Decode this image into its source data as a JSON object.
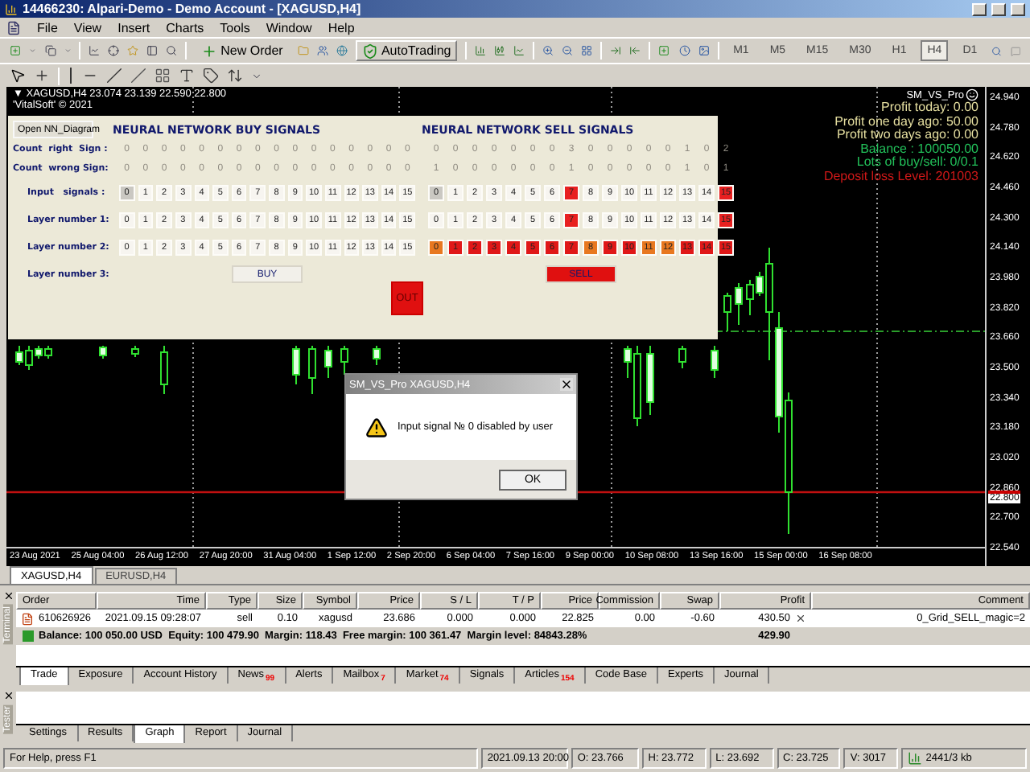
{
  "window": {
    "title": "14466230: Alpari-Demo - Demo Account - [XAGUSD,H4]"
  },
  "menu": [
    "File",
    "View",
    "Insert",
    "Charts",
    "Tools",
    "Window",
    "Help"
  ],
  "toolbar": {
    "new_order": "New Order",
    "autotrading": "AutoTrading",
    "timeframes": [
      {
        "label": "M1",
        "selected": false
      },
      {
        "label": "M5",
        "selected": false
      },
      {
        "label": "M15",
        "selected": false
      },
      {
        "label": "M30",
        "selected": false
      },
      {
        "label": "H1",
        "selected": false
      },
      {
        "label": "H4",
        "selected": true
      },
      {
        "label": "D1",
        "selected": false
      }
    ]
  },
  "chart": {
    "header": "▼ XAGUSD,H4  23.074 23.139 22.590 22.800",
    "copyright": "'VitalSoft' © 2021",
    "expert_name": "SM_VS_Pro",
    "info": [
      {
        "text": "Profit today: 0.00",
        "color": "#e6dfa0"
      },
      {
        "text": "Profit one day ago: 50.00",
        "color": "#e6dfa0"
      },
      {
        "text": "Profit two days ago: 0.00",
        "color": "#e6dfa0"
      },
      {
        "text": "Balance : 100050.00",
        "color": "#22c05a"
      },
      {
        "text": "Lots of buy/sell: 0/0.1",
        "color": "#22c05a"
      },
      {
        "text": "Deposit loss Level: 201003",
        "color": "#d01818"
      }
    ],
    "price_axis": [
      "24.940",
      "24.780",
      "24.620",
      "24.460",
      "24.300",
      "24.140",
      "23.980",
      "23.820",
      "23.660",
      "23.500",
      "23.340",
      "23.180",
      "23.020",
      "22.860",
      "22.700",
      "22.540"
    ],
    "current_price": "22.800",
    "time_axis": [
      "23 Aug 2021",
      "25 Aug 04:00",
      "26 Aug 12:00",
      "27 Aug 20:00",
      "31 Aug 04:00",
      "1 Sep 12:00",
      "2 Sep 20:00",
      "6 Sep 04:00",
      "7 Sep 16:00",
      "9 Sep 00:00",
      "10 Sep 08:00",
      "13 Sep 16:00",
      "15 Sep 00:00",
      "16 Sep 08:00"
    ]
  },
  "nn_panel": {
    "open_button": "Open NN_Diagram",
    "buy_title": "NEURAL NETWORK BUY SIGNALS",
    "sell_title": "NEURAL NETWORK SELL SIGNALS",
    "count_rows": [
      {
        "label": "Count  right  Sign :",
        "buy": [
          "0",
          "0",
          "0",
          "0",
          "0",
          "0",
          "0",
          "0",
          "0",
          "0",
          "0",
          "0",
          "0",
          "0",
          "0",
          "0"
        ],
        "sell": [
          "0",
          "0",
          "0",
          "0",
          "0",
          "0",
          "0",
          "3",
          "0",
          "0",
          "0",
          "0",
          "0",
          "1",
          "0",
          "2"
        ]
      },
      {
        "label": "Count  wrong Sign:",
        "buy": [
          "0",
          "0",
          "0",
          "0",
          "0",
          "0",
          "0",
          "0",
          "0",
          "0",
          "0",
          "0",
          "0",
          "0",
          "0",
          "0"
        ],
        "sell": [
          "1",
          "0",
          "0",
          "0",
          "0",
          "0",
          "0",
          "1",
          "0",
          "0",
          "0",
          "0",
          "0",
          "1",
          "0",
          "1"
        ]
      }
    ],
    "cell_rows": [
      {
        "label": "Input   signals :",
        "buy": [
          {
            "text": "0",
            "color": "#cac8c2"
          },
          {
            "text": "1",
            "color": "#f7f5f0"
          },
          {
            "text": "2",
            "color": "#f7f5f0"
          },
          {
            "text": "3",
            "color": "#f7f5f0"
          },
          {
            "text": "4",
            "color": "#f7f5f0"
          },
          {
            "text": "5",
            "color": "#f7f5f0"
          },
          {
            "text": "6",
            "color": "#f7f5f0"
          },
          {
            "text": "7",
            "color": "#f7f5f0"
          },
          {
            "text": "8",
            "color": "#f7f5f0"
          },
          {
            "text": "9",
            "color": "#f7f5f0"
          },
          {
            "text": "10",
            "color": "#f7f5f0"
          },
          {
            "text": "11",
            "color": "#f7f5f0"
          },
          {
            "text": "12",
            "color": "#f7f5f0"
          },
          {
            "text": "13",
            "color": "#f7f5f0"
          },
          {
            "text": "14",
            "color": "#f7f5f0"
          },
          {
            "text": "15",
            "color": "#f7f5f0"
          }
        ],
        "sell": [
          {
            "text": "0",
            "color": "#cac8c2"
          },
          {
            "text": "1",
            "color": "#f7f5f0"
          },
          {
            "text": "2",
            "color": "#f7f5f0"
          },
          {
            "text": "3",
            "color": "#f7f5f0"
          },
          {
            "text": "4",
            "color": "#f7f5f0"
          },
          {
            "text": "5",
            "color": "#f7f5f0"
          },
          {
            "text": "6",
            "color": "#f7f5f0"
          },
          {
            "text": "7",
            "color": "#e82020"
          },
          {
            "text": "8",
            "color": "#f7f5f0"
          },
          {
            "text": "9",
            "color": "#f7f5f0"
          },
          {
            "text": "10",
            "color": "#f7f5f0"
          },
          {
            "text": "11",
            "color": "#f7f5f0"
          },
          {
            "text": "12",
            "color": "#f7f5f0"
          },
          {
            "text": "13",
            "color": "#f7f5f0"
          },
          {
            "text": "14",
            "color": "#f7f5f0"
          },
          {
            "text": "15",
            "color": "#e82020"
          }
        ]
      },
      {
        "label": "Layer number 1:",
        "buy": [
          {
            "text": "0",
            "color": "#f7f5f0"
          },
          {
            "text": "1",
            "color": "#f7f5f0"
          },
          {
            "text": "2",
            "color": "#f7f5f0"
          },
          {
            "text": "3",
            "color": "#f7f5f0"
          },
          {
            "text": "4",
            "color": "#f7f5f0"
          },
          {
            "text": "5",
            "color": "#f7f5f0"
          },
          {
            "text": "6",
            "color": "#f7f5f0"
          },
          {
            "text": "7",
            "color": "#f7f5f0"
          },
          {
            "text": "8",
            "color": "#f7f5f0"
          },
          {
            "text": "9",
            "color": "#f7f5f0"
          },
          {
            "text": "10",
            "color": "#f7f5f0"
          },
          {
            "text": "11",
            "color": "#f7f5f0"
          },
          {
            "text": "12",
            "color": "#f7f5f0"
          },
          {
            "text": "13",
            "color": "#f7f5f0"
          },
          {
            "text": "14",
            "color": "#f7f5f0"
          },
          {
            "text": "15",
            "color": "#f7f5f0"
          }
        ],
        "sell": [
          {
            "text": "0",
            "color": "#f7f5f0"
          },
          {
            "text": "1",
            "color": "#f7f5f0"
          },
          {
            "text": "2",
            "color": "#f7f5f0"
          },
          {
            "text": "3",
            "color": "#f7f5f0"
          },
          {
            "text": "4",
            "color": "#f7f5f0"
          },
          {
            "text": "5",
            "color": "#f7f5f0"
          },
          {
            "text": "6",
            "color": "#f7f5f0"
          },
          {
            "text": "7",
            "color": "#e82020"
          },
          {
            "text": "8",
            "color": "#f7f5f0"
          },
          {
            "text": "9",
            "color": "#f7f5f0"
          },
          {
            "text": "10",
            "color": "#f7f5f0"
          },
          {
            "text": "11",
            "color": "#f7f5f0"
          },
          {
            "text": "12",
            "color": "#f7f5f0"
          },
          {
            "text": "13",
            "color": "#f7f5f0"
          },
          {
            "text": "14",
            "color": "#f7f5f0"
          },
          {
            "text": "15",
            "color": "#e82020"
          }
        ]
      },
      {
        "label": "Layer number 2:",
        "buy": [
          {
            "text": "0",
            "color": "#f7f5f0"
          },
          {
            "text": "1",
            "color": "#f7f5f0"
          },
          {
            "text": "2",
            "color": "#f7f5f0"
          },
          {
            "text": "3",
            "color": "#f7f5f0"
          },
          {
            "text": "4",
            "color": "#f7f5f0"
          },
          {
            "text": "5",
            "color": "#f7f5f0"
          },
          {
            "text": "6",
            "color": "#f7f5f0"
          },
          {
            "text": "7",
            "color": "#f7f5f0"
          },
          {
            "text": "8",
            "color": "#f7f5f0"
          },
          {
            "text": "9",
            "color": "#f7f5f0"
          },
          {
            "text": "10",
            "color": "#f7f5f0"
          },
          {
            "text": "11",
            "color": "#f7f5f0"
          },
          {
            "text": "12",
            "color": "#f7f5f0"
          },
          {
            "text": "13",
            "color": "#f7f5f0"
          },
          {
            "text": "14",
            "color": "#f7f5f0"
          },
          {
            "text": "15",
            "color": "#f7f5f0"
          }
        ],
        "sell": [
          {
            "text": "0",
            "color": "#e87820"
          },
          {
            "text": "1",
            "color": "#e01818"
          },
          {
            "text": "2",
            "color": "#e01818"
          },
          {
            "text": "3",
            "color": "#e01818"
          },
          {
            "text": "4",
            "color": "#e01818"
          },
          {
            "text": "5",
            "color": "#e01818"
          },
          {
            "text": "6",
            "color": "#e01818"
          },
          {
            "text": "7",
            "color": "#e01818"
          },
          {
            "text": "8",
            "color": "#e87820"
          },
          {
            "text": "9",
            "color": "#e01818"
          },
          {
            "text": "10",
            "color": "#e01818"
          },
          {
            "text": "11",
            "color": "#e87820"
          },
          {
            "text": "12",
            "color": "#e87820"
          },
          {
            "text": "13",
            "color": "#e01818"
          },
          {
            "text": "14",
            "color": "#e01818"
          },
          {
            "text": "15",
            "color": "#e01818"
          }
        ]
      }
    ],
    "layer3_label": "Layer number 3:",
    "buy_button": {
      "text": "BUY",
      "color": "#f2f0ea"
    },
    "sell_button": {
      "text": "SELL",
      "color": "#e01010"
    },
    "out_button": {
      "text": "OUT",
      "color": "#e01010"
    }
  },
  "dialog": {
    "title": "SM_VS_Pro XAGUSD,H4",
    "message": "Input signal № 0 disabled by user",
    "ok": "OK"
  },
  "chart_tabs": [
    {
      "label": "XAGUSD,H4",
      "selected": true
    },
    {
      "label": "EURUSD,H4",
      "selected": false
    }
  ],
  "terminal": {
    "side_label": "Terminal",
    "columns": [
      "Order",
      "Time",
      "Type",
      "Size",
      "Symbol",
      "Price",
      "S / L",
      "T / P",
      "Price",
      "Commission",
      "Swap",
      "Profit",
      "Comment"
    ],
    "rows": [
      {
        "cells": [
          "610626926",
          "2021.09.15 09:28:07",
          "sell",
          "0.10",
          "xagusd",
          "23.686",
          "0.000",
          "0.000",
          "22.825",
          "0.00",
          "-0.60",
          "430.50",
          "0_Grid_SELL_magic=2"
        ]
      }
    ],
    "summary": {
      "text": "Balance: 100 050.00 USD  Equity: 100 479.90  Margin: 118.43  Free margin: 100 361.47  Margin level: 84843.28%",
      "profit": "429.90"
    },
    "tabs": [
      {
        "label": "Trade",
        "selected": true
      },
      {
        "label": "Exposure",
        "selected": false
      },
      {
        "label": "Account History",
        "selected": false
      },
      {
        "label": "News",
        "badge": "99",
        "selected": false
      },
      {
        "label": "Alerts",
        "selected": false
      },
      {
        "label": "Mailbox",
        "badge": "7",
        "selected": false
      },
      {
        "label": "Market",
        "badge": "74",
        "selected": false
      },
      {
        "label": "Signals",
        "selected": false
      },
      {
        "label": "Articles",
        "badge": "154",
        "selected": false
      },
      {
        "label": "Code Base",
        "selected": false
      },
      {
        "label": "Experts",
        "selected": false
      },
      {
        "label": "Journal",
        "selected": false
      }
    ]
  },
  "tester": {
    "side_label": "Tester",
    "tabs": [
      {
        "label": "Settings",
        "selected": false
      },
      {
        "label": "Results",
        "selected": false
      },
      {
        "label": "Graph",
        "selected": true
      },
      {
        "label": "Report",
        "selected": false
      },
      {
        "label": "Journal",
        "selected": false
      }
    ]
  },
  "status_bar": {
    "help": "For Help, press F1",
    "datetime": "2021.09.13 20:00",
    "open": "O: 23.766",
    "high": "H: 23.772",
    "low": "L: 23.692",
    "close": "C: 23.725",
    "volume": "V: 3017",
    "traffic": "2441/3 kb"
  }
}
